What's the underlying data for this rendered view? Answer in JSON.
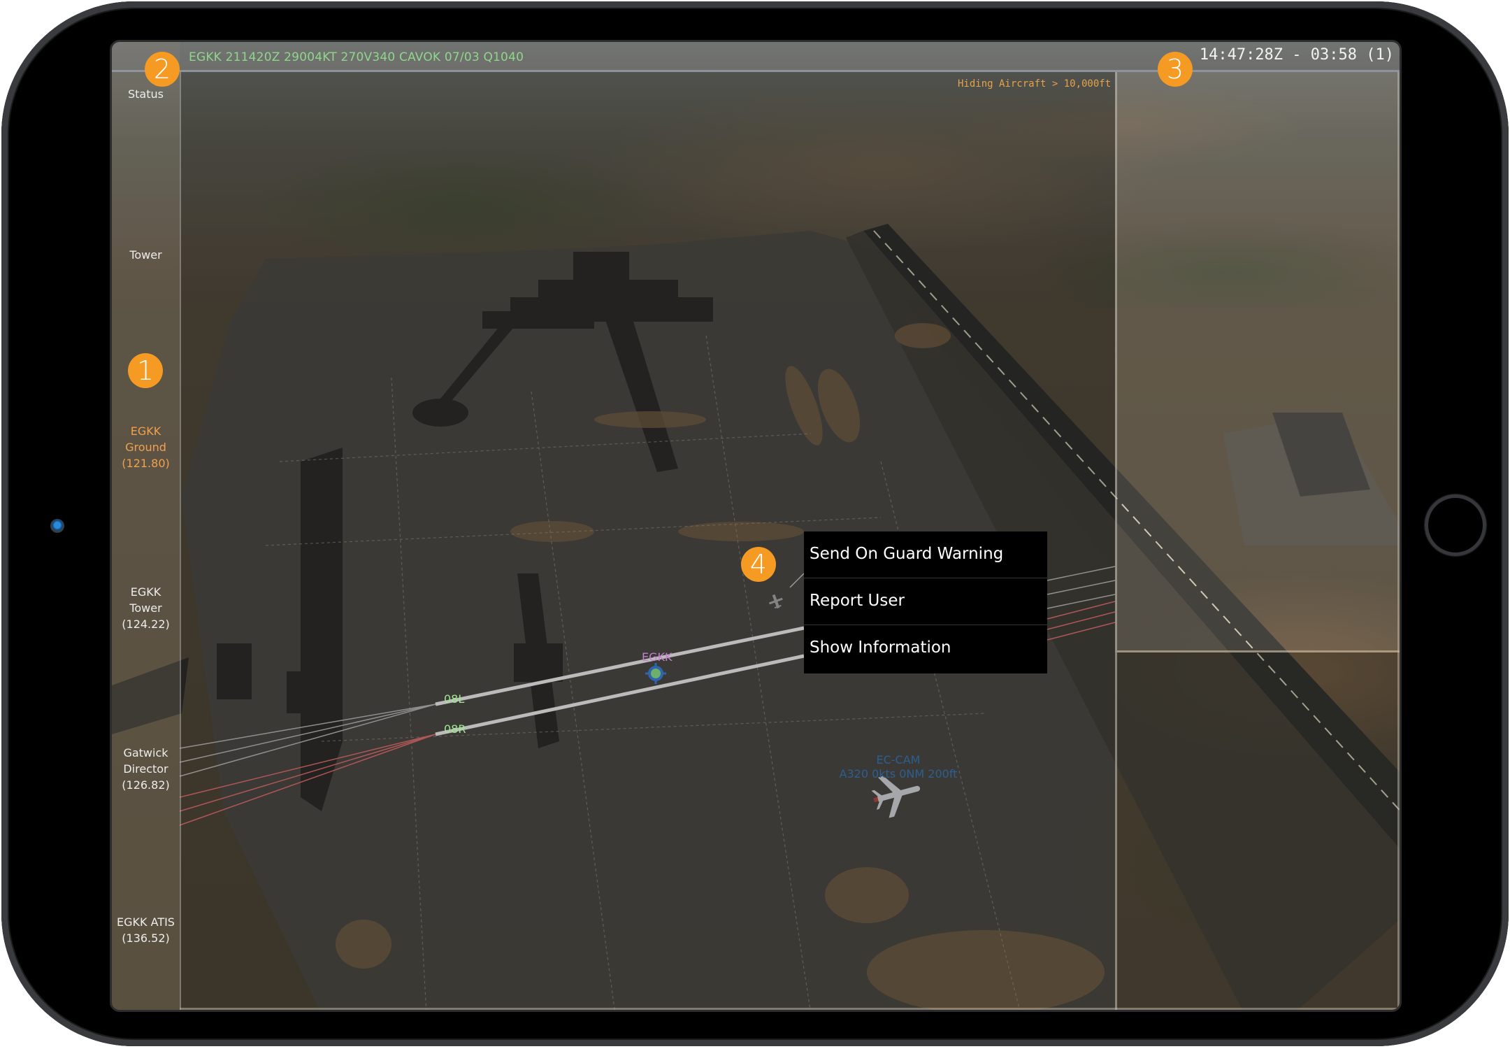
{
  "device": {
    "camera_icon": "front-camera",
    "home_button_icon": "home-button-ring"
  },
  "topbar": {
    "metar": "EGKK 211420Z 29004KT 270V340 CAVOK 07/03 Q1040",
    "clock": "14:47:28Z - 03:58 (1)"
  },
  "filter_note": "Hiding Aircraft > 10,000ft",
  "sidebar": {
    "items": [
      {
        "label": "Status",
        "active": false
      },
      {
        "label": "Tower",
        "active": false
      },
      {
        "label": "EGKK\nGround\n(121.80)",
        "lines": [
          "EGKK",
          "Ground",
          "(121.80)"
        ],
        "active": true
      },
      {
        "label": "EGKK\nTower\n(124.22)",
        "lines": [
          "EGKK",
          "Tower",
          "(124.22)"
        ],
        "active": false
      },
      {
        "label": "Gatwick\nDirector\n(126.82)",
        "lines": [
          "Gatwick",
          "Director",
          "(126.82)"
        ],
        "active": false
      },
      {
        "label": "EGKK ATIS\n(136.52)",
        "lines": [
          "EGKK ATIS",
          "(136.52)"
        ],
        "active": false
      }
    ]
  },
  "callouts": [
    "1",
    "2",
    "3",
    "4"
  ],
  "map": {
    "airport_label": "EGKK",
    "runways": [
      "08L",
      "08R"
    ],
    "aircraft": {
      "callsign": "EC-CAM",
      "details": "A320 0kts 0NM 200ft"
    },
    "colors": {
      "runway_label": "#9ee890",
      "airport_label": "#c77fd3",
      "aircraft_label": "#2c5f92",
      "approach_line_grey": "#b8b8b8",
      "approach_line_red": "#e07070",
      "airport_marker": "#3b82e0"
    }
  },
  "context_menu": {
    "items": [
      {
        "label": "Send On Guard Warning"
      },
      {
        "label": "Report User"
      },
      {
        "label": "Show Information"
      }
    ]
  },
  "accent_color": "#f59a23"
}
